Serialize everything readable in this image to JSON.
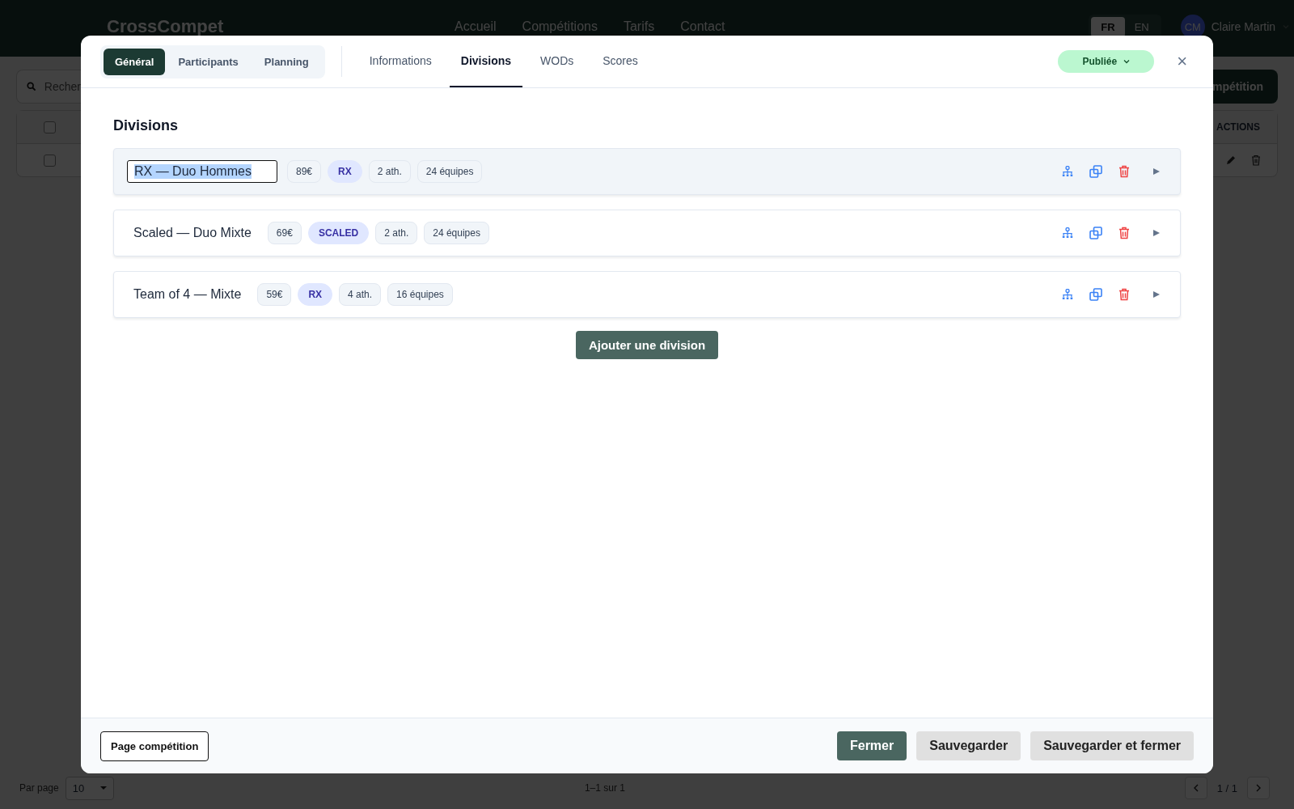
{
  "app_header": {
    "logo": "CrossCompet",
    "nav": [
      {
        "label": "Accueil"
      },
      {
        "label": "Compétitions"
      },
      {
        "label": "Tarifs"
      },
      {
        "label": "Contact"
      }
    ],
    "languages": [
      {
        "label": "FR",
        "selected": true
      },
      {
        "label": "EN",
        "selected": false
      }
    ],
    "user": {
      "initials": "CM",
      "name": "Claire Martin"
    }
  },
  "background": {
    "search": {
      "placeholder": "Recher"
    },
    "create_button": "mpétition",
    "table": {
      "actions_header": "ACTIONS",
      "header_checkbox": {
        "checked": false
      },
      "rows": [
        {
          "checked": false
        }
      ]
    },
    "pagination": {
      "per_page_label": "Par page",
      "per_page": "10",
      "range": "1–1 sur 1",
      "page": "1 / 1"
    }
  },
  "modal": {
    "sections": [
      {
        "label": "Général",
        "selected": true
      },
      {
        "label": "Participants",
        "selected": false
      },
      {
        "label": "Planning",
        "selected": false
      }
    ],
    "tabs": [
      {
        "label": "Informations",
        "selected": false
      },
      {
        "label": "Divisions",
        "selected": true
      },
      {
        "label": "WODs",
        "selected": false
      },
      {
        "label": "Scores",
        "selected": false
      }
    ],
    "status": "Publiée",
    "close": "×",
    "heading": "Divisions",
    "divisions": [
      {
        "name": "RX — Duo Hommes",
        "editing": true,
        "price": "89€",
        "level": "RX",
        "athletes": "2 ath.",
        "teams": "24 équipes"
      },
      {
        "name": "Scaled — Duo Mixte",
        "editing": false,
        "price": "69€",
        "level": "SCALED",
        "athletes": "2 ath.",
        "teams": "24 équipes"
      },
      {
        "name": "Team of 4 — Mixte",
        "editing": false,
        "price": "59€",
        "level": "RX",
        "athletes": "4 ath.",
        "teams": "16 équipes"
      }
    ],
    "add_button": "Ajouter une division",
    "footer": {
      "left_button": "Page compétition",
      "buttons": [
        {
          "label": "Fermer",
          "kind": "primary"
        },
        {
          "label": "Sauvegarder",
          "kind": "secondary"
        },
        {
          "label": "Sauvegarder et fermer",
          "kind": "secondary"
        }
      ]
    }
  }
}
